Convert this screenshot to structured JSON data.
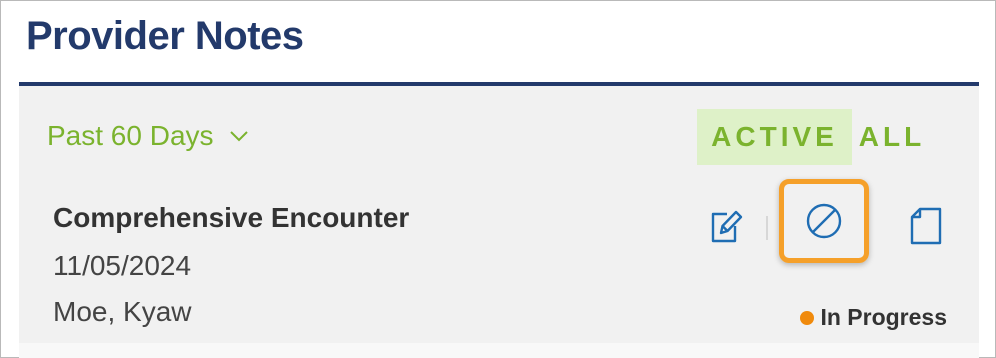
{
  "header": {
    "title": "Provider Notes"
  },
  "filter": {
    "range_label": "Past 60 Days"
  },
  "tabs": [
    {
      "label": "ACTIVE",
      "selected": true
    },
    {
      "label": "ALL",
      "selected": false
    }
  ],
  "encounter": {
    "title": "Comprehensive Encounter",
    "date": "11/05/2024",
    "provider": "Moe, Kyaw",
    "status": "In Progress",
    "status_color": "#f08a0c",
    "actions": [
      {
        "icon": "edit-icon"
      },
      {
        "icon": "void-icon",
        "highlighted": true
      },
      {
        "icon": "document-icon"
      }
    ]
  },
  "colors": {
    "brand_navy": "#233a6b",
    "accent_green": "#7bb32e",
    "active_tab_bg": "#def1c8",
    "icon_blue": "#1f6db3",
    "highlight_orange": "#f5a02a"
  }
}
